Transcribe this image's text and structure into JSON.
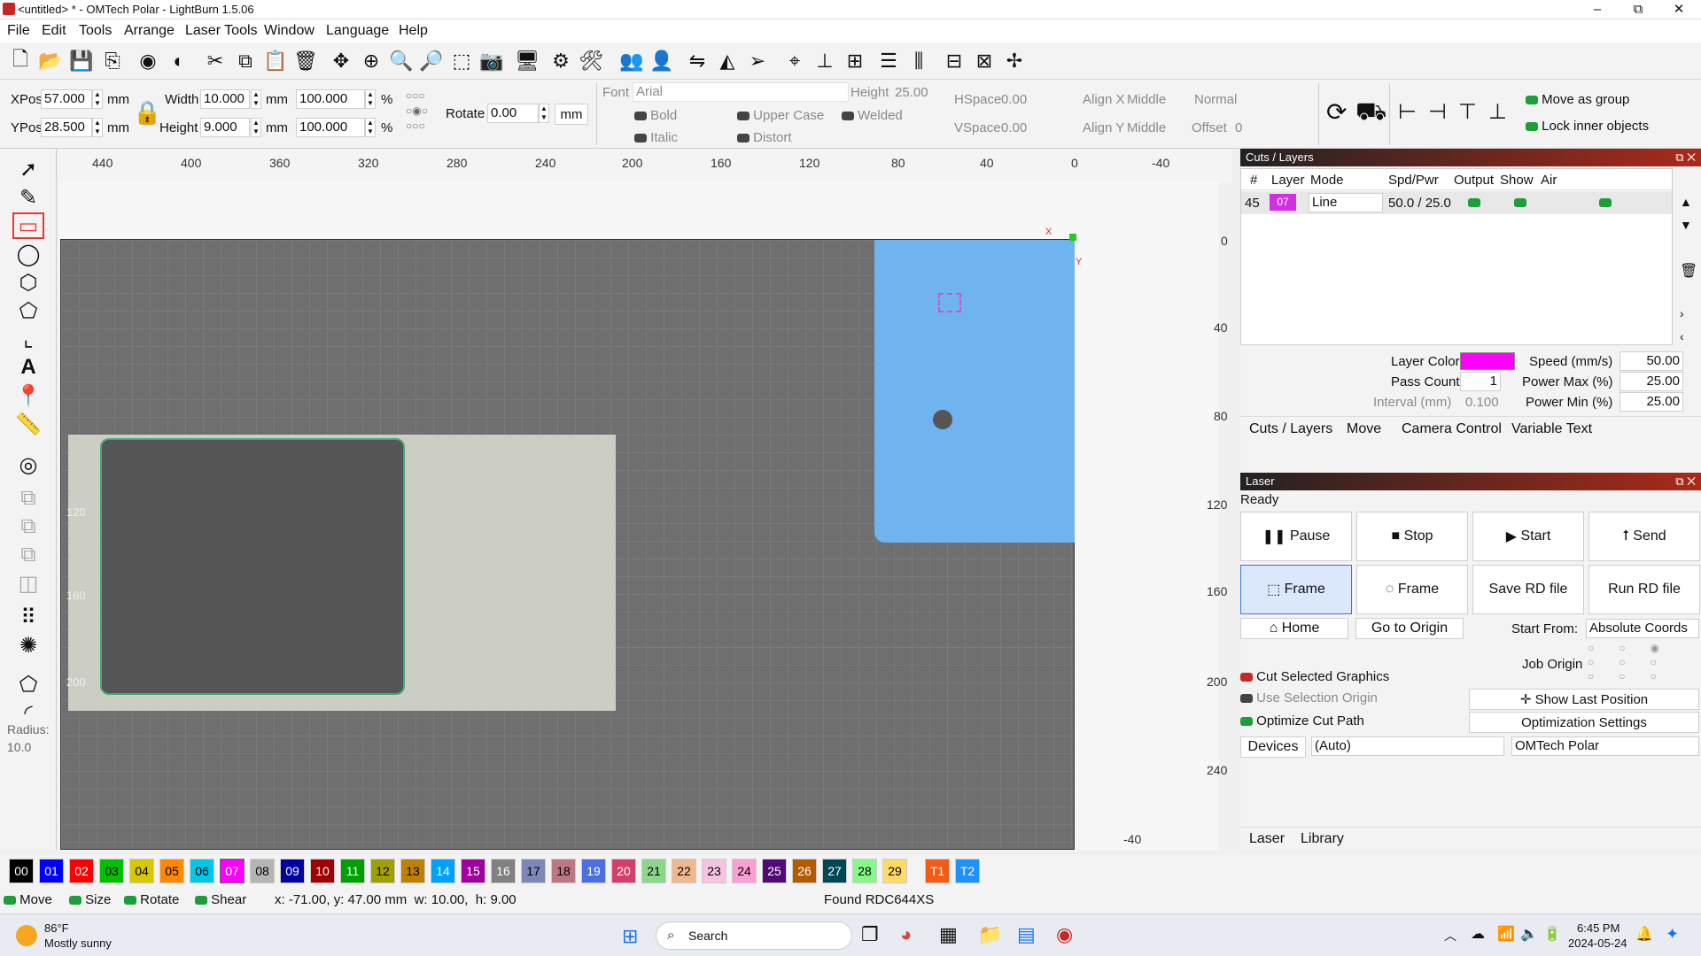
{
  "window": {
    "title": "<untitled> * - OMTech Polar - LightBurn 1.5.06",
    "minimize": "–",
    "maximize": "⧉",
    "close": "✕"
  },
  "menu": [
    "File",
    "Edit",
    "Tools",
    "Arrange",
    "Laser Tools",
    "Window",
    "Language",
    "Help"
  ],
  "props": {
    "xpos_label": "XPos",
    "xpos": "57.000",
    "ypos_label": "YPos",
    "ypos": "28.500",
    "unit": "mm",
    "width_label": "Width",
    "width": "10.000",
    "height_label": "Height",
    "height": "9.000",
    "pct_w": "100.000",
    "pct_h": "100.000",
    "pct": "%",
    "rotate_label": "Rotate",
    "rotate": "0.00",
    "rotate_unit": "mm",
    "font_label": "Font",
    "font": "Arial",
    "font_height_label": "Height",
    "font_height": "25.00",
    "bold": "Bold",
    "italic": "Italic",
    "upper": "Upper Case",
    "distort": "Distort",
    "welded": "Welded",
    "hspace_label": "HSpace",
    "hspace": "0.00",
    "vspace_label": "VSpace",
    "vspace": "0.00",
    "alignx_label": "Align X",
    "alignx": "Middle",
    "aligny_label": "Align Y",
    "aligny": "Middle",
    "normal": "Normal",
    "offset_label": "Offset",
    "offset": "0",
    "move_group": "Move as group",
    "lock_inner": "Lock inner objects"
  },
  "radius": {
    "label": "Radius:",
    "value": "10.0"
  },
  "ruler": {
    "top": [
      "440",
      "400",
      "360",
      "320",
      "280",
      "240",
      "200",
      "160",
      "120",
      "80",
      "40",
      "0",
      "-40"
    ],
    "right": [
      "0",
      "40",
      "80",
      "120",
      "160",
      "200",
      "240",
      "-40"
    ],
    "left": [
      "120",
      "160",
      "200"
    ],
    "origin_x": "X",
    "origin_y": "Y"
  },
  "cuts": {
    "title": "Cuts / Layers",
    "headers": [
      "#",
      "Layer",
      "Mode",
      "Spd/Pwr",
      "Output",
      "Show",
      "Air"
    ],
    "row": {
      "num": "45",
      "layer": "07",
      "mode": "Line",
      "spdpwr": "50.0 / 25.0"
    },
    "layer_color_label": "Layer Color",
    "speed_label": "Speed (mm/s)",
    "speed": "50.00",
    "pass_label": "Pass Count",
    "pass": "1",
    "pmax_label": "Power Max (%)",
    "pmax": "25.00",
    "interval_label": "Interval (mm)",
    "interval": "0.100",
    "pmin_label": "Power Min (%)",
    "pmin": "25.00",
    "tabs": [
      "Cuts / Layers",
      "Move",
      "Camera Control",
      "Variable Text"
    ]
  },
  "laser": {
    "title": "Laser",
    "status": "Ready",
    "pause": "Pause",
    "stop": "Stop",
    "start": "Start",
    "send": "Send",
    "frame1": "Frame",
    "frame2": "Frame",
    "save_rd": "Save RD file",
    "run_rd": "Run RD file",
    "home": "Home",
    "go_origin": "Go to Origin",
    "start_from_label": "Start From:",
    "start_from": "Absolute Coords",
    "job_origin": "Job Origin",
    "cut_selected": "Cut Selected Graphics",
    "use_sel_origin": "Use Selection Origin",
    "optimize": "Optimize Cut Path",
    "show_last": "Show Last Position",
    "opt_settings": "Optimization Settings",
    "devices": "Devices",
    "auto": "(Auto)",
    "device": "OMTech Polar",
    "tabs": [
      "Laser",
      "Library"
    ]
  },
  "palette": [
    {
      "l": "00",
      "c": "#000000",
      "t": "#fff"
    },
    {
      "l": "01",
      "c": "#0000ff",
      "t": "#fff"
    },
    {
      "l": "02",
      "c": "#ff0000",
      "t": "#fff"
    },
    {
      "l": "03",
      "c": "#00c000",
      "t": "#000"
    },
    {
      "l": "04",
      "c": "#d8c800",
      "t": "#000"
    },
    {
      "l": "05",
      "c": "#ff8800",
      "t": "#000"
    },
    {
      "l": "06",
      "c": "#00c8e8",
      "t": "#000"
    },
    {
      "l": "07",
      "c": "#ff00ff",
      "t": "#fff"
    },
    {
      "l": "08",
      "c": "#b4b4b4",
      "t": "#000"
    },
    {
      "l": "09",
      "c": "#0000a0",
      "t": "#fff"
    },
    {
      "l": "10",
      "c": "#a00000",
      "t": "#fff"
    },
    {
      "l": "11",
      "c": "#00a000",
      "t": "#fff"
    },
    {
      "l": "12",
      "c": "#a0a000",
      "t": "#000"
    },
    {
      "l": "13",
      "c": "#c08000",
      "t": "#000"
    },
    {
      "l": "14",
      "c": "#00a0ff",
      "t": "#fff"
    },
    {
      "l": "15",
      "c": "#a000a0",
      "t": "#fff"
    },
    {
      "l": "16",
      "c": "#808080",
      "t": "#fff"
    },
    {
      "l": "17",
      "c": "#7d87b9",
      "t": "#000"
    },
    {
      "l": "18",
      "c": "#bb7784",
      "t": "#000"
    },
    {
      "l": "19",
      "c": "#4a6fe3",
      "t": "#fff"
    },
    {
      "l": "20",
      "c": "#d33f6a",
      "t": "#fff"
    },
    {
      "l": "21",
      "c": "#8cd78c",
      "t": "#000"
    },
    {
      "l": "22",
      "c": "#f0b98d",
      "t": "#000"
    },
    {
      "l": "23",
      "c": "#f6c4e1",
      "t": "#000"
    },
    {
      "l": "24",
      "c": "#fa9ed4",
      "t": "#000"
    },
    {
      "l": "25",
      "c": "#500a78",
      "t": "#fff"
    },
    {
      "l": "26",
      "c": "#b45a00",
      "t": "#fff"
    },
    {
      "l": "27",
      "c": "#004754",
      "t": "#fff"
    },
    {
      "l": "28",
      "c": "#86fa88",
      "t": "#000"
    },
    {
      "l": "29",
      "c": "#ffdb66",
      "t": "#000"
    },
    {
      "l": "T1",
      "c": "#f35a14",
      "t": "#fff"
    },
    {
      "l": "T2",
      "c": "#1e90ff",
      "t": "#fff"
    }
  ],
  "status": {
    "move": "Move",
    "size": "Size",
    "rotate": "Rotate",
    "shear": "Shear",
    "coords": "x: -71.00, y: 47.00 mm  w: 10.00,  h: 9.00",
    "found": "Found RDC644XS"
  },
  "taskbar": {
    "temp": "86°F",
    "weather": "Mostly sunny",
    "search": "Search",
    "time": "6:45 PM",
    "date": "2024-05-24"
  }
}
